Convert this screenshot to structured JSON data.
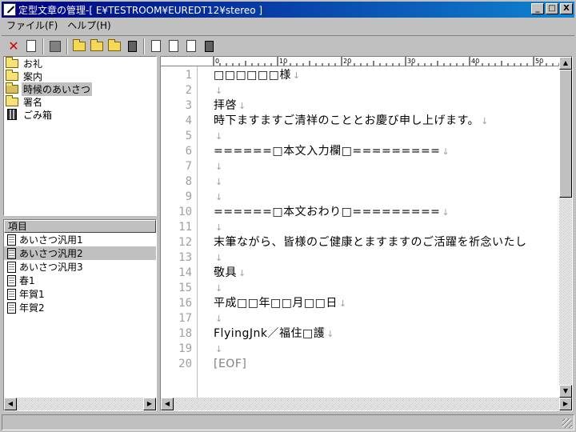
{
  "window": {
    "title": "定型文章の管理-[ E¥TESTROOM¥EUREDT12¥stereo ]",
    "min": "_",
    "max": "□",
    "close": "X"
  },
  "menu": [
    {
      "label": "ファイル(F)"
    },
    {
      "label": "ヘルプ(H)"
    }
  ],
  "toolbar": {
    "delete_glyph": "✕"
  },
  "folders": [
    {
      "label": "お礼",
      "icon": "folder-icon"
    },
    {
      "label": "案内",
      "icon": "folder-icon"
    },
    {
      "label": "時候のあいさつ",
      "icon": "open-folder-icon"
    },
    {
      "label": "署名",
      "icon": "folder-icon"
    },
    {
      "label": "ごみ箱",
      "icon": "trash-icon"
    }
  ],
  "items_header": "項目",
  "items": [
    {
      "label": "あいさつ汎用1"
    },
    {
      "label": "あいさつ汎用2"
    },
    {
      "label": "あいさつ汎用3"
    },
    {
      "label": "春1"
    },
    {
      "label": "年賀1"
    },
    {
      "label": "年賀2"
    }
  ],
  "ruler": [
    "0",
    "10",
    "20",
    "30",
    "40",
    "50"
  ],
  "editor_lines": [
    {
      "no": "1",
      "text": "□□□□□□様",
      "nl": "↓"
    },
    {
      "no": "2",
      "text": "",
      "nl": "↓"
    },
    {
      "no": "3",
      "text": "拝啓",
      "nl": "↓"
    },
    {
      "no": "4",
      "text": "時下ますますご清祥のこととお慶び申し上げます。",
      "nl": "↓"
    },
    {
      "no": "5",
      "text": "",
      "nl": "↓"
    },
    {
      "no": "6",
      "text": "======□本文入力欄□=========",
      "nl": "↓"
    },
    {
      "no": "7",
      "text": "",
      "nl": "↓"
    },
    {
      "no": "8",
      "text": "",
      "nl": "↓"
    },
    {
      "no": "9",
      "text": "",
      "nl": "↓"
    },
    {
      "no": "10",
      "text": "======□本文おわり□=========",
      "nl": "↓"
    },
    {
      "no": "11",
      "text": "",
      "nl": "↓"
    },
    {
      "no": "12",
      "text": "末筆ながら、皆様のご健康とますますのご活躍を祈念いたし",
      "nl": ""
    },
    {
      "no": "13",
      "text": "",
      "nl": "↓"
    },
    {
      "no": "14",
      "text": "敬具",
      "nl": "↓"
    },
    {
      "no": "15",
      "text": "",
      "nl": "↓"
    },
    {
      "no": "16",
      "text": "平成□□年□□月□□日",
      "nl": "↓"
    },
    {
      "no": "17",
      "text": "",
      "nl": "↓"
    },
    {
      "no": "18",
      "text": "FlyingJnk／福住□護",
      "nl": "↓"
    },
    {
      "no": "19",
      "text": "",
      "nl": "↓"
    },
    {
      "no": "20",
      "text": "[EOF]",
      "nl": ""
    }
  ],
  "selected_folder_index": 2,
  "selected_item_index": 1
}
